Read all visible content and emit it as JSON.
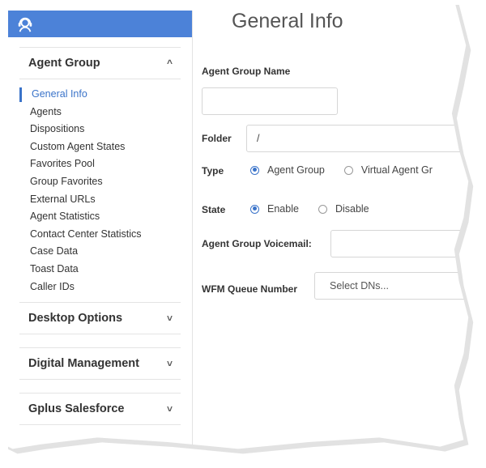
{
  "page": {
    "title": "General Info"
  },
  "sidebar": {
    "logo_icon": "agent-headset-icon",
    "accent_color": "#4c82d8",
    "sections": [
      {
        "label": "Agent Group",
        "expanded": true
      },
      {
        "label": "Desktop Options",
        "expanded": false
      },
      {
        "label": "Digital Management",
        "expanded": false
      },
      {
        "label": "Gplus Salesforce",
        "expanded": false
      }
    ],
    "items": [
      {
        "label": "General Info",
        "active": true
      },
      {
        "label": "Agents"
      },
      {
        "label": "Dispositions"
      },
      {
        "label": "Custom Agent States"
      },
      {
        "label": "Favorites Pool"
      },
      {
        "label": "Group Favorites"
      },
      {
        "label": "External URLs"
      },
      {
        "label": "Agent Statistics"
      },
      {
        "label": "Contact Center Statistics"
      },
      {
        "label": "Case Data"
      },
      {
        "label": "Toast Data"
      },
      {
        "label": "Caller IDs"
      }
    ],
    "chevron_up": "^",
    "chevron_down": "˅"
  },
  "form": {
    "agent_group_name_label": "Agent Group Name",
    "agent_group_name_value": "",
    "folder_label": "Folder",
    "folder_value": "/",
    "type_label": "Type",
    "type_options": [
      "Agent Group",
      "Virtual Agent Gr"
    ],
    "type_selected": 0,
    "state_label": "State",
    "state_options": [
      "Enable",
      "Disable"
    ],
    "state_selected": 0,
    "voicemail_label": "Agent Group Voicemail:",
    "voicemail_value": "",
    "wfm_label": "WFM Queue Number",
    "wfm_placeholder": "Select DNs..."
  }
}
